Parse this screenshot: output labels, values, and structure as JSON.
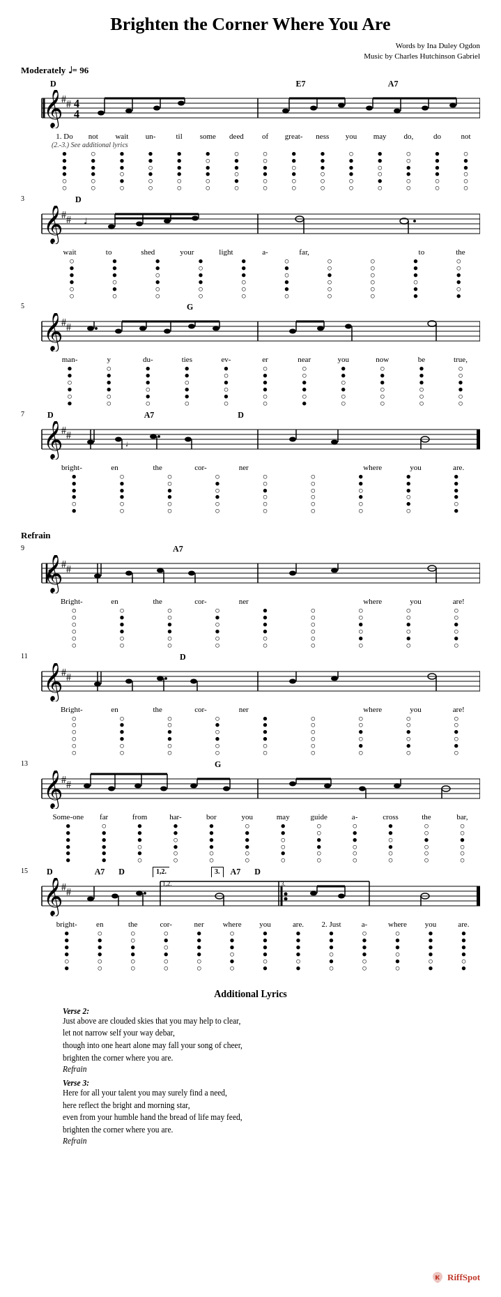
{
  "title": "Brighten the Corner Where You Are",
  "attribution": {
    "line1": "Words by Ina Duley Ogdon",
    "line2": "Music by Charles Hutchinson Gabriel"
  },
  "tempo": {
    "label": "Moderately",
    "bpm": "♩= 96"
  },
  "sections": {
    "refrain_label": "Refrain",
    "additional_label": "Additional Lyrics"
  },
  "verses": {
    "verse2_label": "Verse 2:",
    "verse2_lines": [
      "Just above are clouded skies that you may help to clear,",
      "let not narrow self your way debar,",
      "though into one heart alone may fall your song of cheer,",
      "brighten the corner where you are."
    ],
    "verse2_refrain": "Refrain",
    "verse3_label": "Verse 3:",
    "verse3_lines": [
      "Here for all your talent you may surely find a need,",
      "here reflect the bright and morning star,",
      "even from your humble hand the bread of life may feed,",
      "brighten the corner where you are."
    ],
    "verse3_refrain": "Refrain"
  },
  "watermark": "RiffSpot",
  "staff1": {
    "chords": [
      "D",
      "",
      "",
      "E7",
      "A7"
    ],
    "lyrics": [
      "1. Do",
      "not",
      "wait",
      "un-",
      "til",
      "some",
      "deed",
      "of",
      "great-",
      "ness",
      "you",
      "may",
      "do,",
      "do",
      "not"
    ],
    "lyrics_sub": "(2.-3.) See additional lyrics"
  },
  "staff2": {
    "measure_num": "3",
    "chords": [
      "",
      "D"
    ],
    "lyrics": [
      "wait",
      "to",
      "shed",
      "your",
      "light",
      "a-",
      "far,",
      "",
      "to",
      "the"
    ]
  },
  "staff3": {
    "measure_num": "5",
    "chords": [
      "",
      "G"
    ],
    "lyrics": [
      "man-",
      "y",
      "du-",
      "ties",
      "ev-",
      "er",
      "near",
      "you",
      "now",
      "be",
      "true,"
    ]
  },
  "staff4": {
    "measure_num": "7",
    "chords": [
      "D",
      "",
      "A7",
      "",
      "D"
    ],
    "lyrics": [
      "bright-",
      "en",
      "the",
      "cor-",
      "ner",
      "",
      "where",
      "you",
      "are."
    ]
  },
  "staff5": {
    "measure_num": "9",
    "chords": [
      "",
      "",
      "A7"
    ],
    "lyrics": [
      "Bright-",
      "en",
      "the",
      "cor-",
      "ner",
      "",
      "where",
      "you",
      "are!"
    ]
  },
  "staff6": {
    "measure_num": "11",
    "chords": [
      "",
      "D"
    ],
    "lyrics": [
      "Bright-",
      "en",
      "the",
      "cor-",
      "ner",
      "",
      "where",
      "you",
      "are!"
    ]
  },
  "staff7": {
    "measure_num": "13",
    "chords": [
      "",
      "",
      "G"
    ],
    "lyrics": [
      "Some-one",
      "far",
      "from",
      "har-",
      "bor",
      "you",
      "may",
      "guide",
      "a-",
      "cross",
      "the",
      "bar,"
    ]
  },
  "staff8": {
    "measure_num": "15",
    "chords": [
      "D",
      "A7",
      "D",
      "3.",
      "A7",
      "D"
    ],
    "volta": [
      "1,2.",
      "3."
    ],
    "lyrics": [
      "bright-",
      "en",
      "the",
      "cor-",
      "ner",
      "where",
      "you",
      "are.",
      "2. Just",
      "a-",
      "where",
      "you",
      "are."
    ]
  }
}
